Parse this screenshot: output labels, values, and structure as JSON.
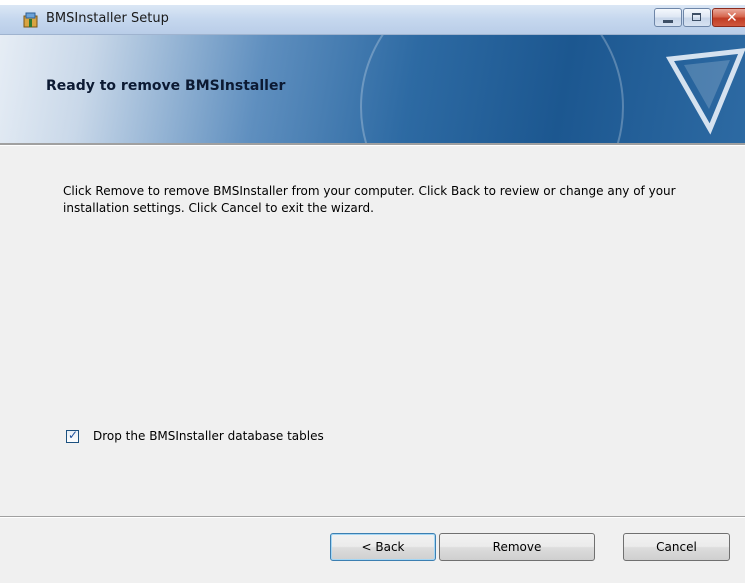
{
  "window": {
    "title": "BMSInstaller Setup",
    "close_glyph": "✕"
  },
  "banner": {
    "title": "Ready to remove BMSInstaller"
  },
  "content": {
    "description": "Click Remove to remove BMSInstaller from your computer. Click Back to review or change any of your installation settings. Click Cancel to exit the wizard.",
    "checkbox": {
      "label": "Drop the BMSInstaller database tables",
      "checked": true,
      "glyph": "✓"
    }
  },
  "buttons": {
    "back": "< Back",
    "remove": "Remove",
    "cancel": "Cancel"
  },
  "icons": [
    "installer-app-icon",
    "minimize-icon",
    "maximize-icon",
    "close-icon",
    "setup-logo-icon",
    "check-icon"
  ],
  "colors": {
    "banner_dark": "#1c5790",
    "titlebar": "#c5d7ee",
    "close_button": "#c13c24",
    "dialog_bg": "#f0f0f0"
  }
}
